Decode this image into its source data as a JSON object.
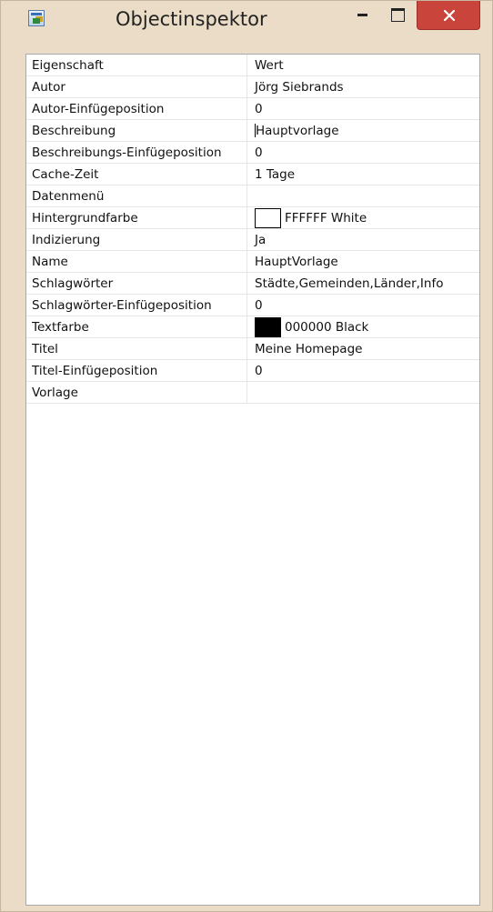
{
  "window": {
    "title": "Objectinspektor",
    "icon": "object-inspector-app-icon",
    "controls": [
      "minimize-icon",
      "maximize-icon",
      "close-icon"
    ],
    "colors": {
      "frame": "#eadcc6",
      "close": "#c9443b"
    }
  },
  "grid": {
    "columns": {
      "property": "Eigenschaft",
      "value": "Wert"
    },
    "rows": [
      {
        "name": "Autor",
        "value": "Jörg Siebrands"
      },
      {
        "name": "Autor-Einfügeposition",
        "value": "0"
      },
      {
        "name": "Beschreibung",
        "value": "Hauptvorlage"
      },
      {
        "name": "Beschreibungs-Einfügeposition",
        "value": "0"
      },
      {
        "name": "Cache-Zeit",
        "value": "1 Tage"
      },
      {
        "name": "Datenmenü",
        "value": ""
      },
      {
        "name": "Hintergrundfarbe",
        "value": "FFFFFF White",
        "swatch": "#FFFFFF"
      },
      {
        "name": "Indizierung",
        "value": "Ja"
      },
      {
        "name": "Name",
        "value": "HauptVorlage"
      },
      {
        "name": "Schlagwörter",
        "value": "Städte,Gemeinden,Länder,Info"
      },
      {
        "name": "Schlagwörter-Einfügeposition",
        "value": "0"
      },
      {
        "name": "Textfarbe",
        "value": "000000 Black",
        "swatch": "#000000"
      },
      {
        "name": "Titel",
        "value": "Meine Homepage"
      },
      {
        "name": "Titel-Einfügeposition",
        "value": "0"
      },
      {
        "name": "Vorlage",
        "value": ""
      }
    ]
  }
}
